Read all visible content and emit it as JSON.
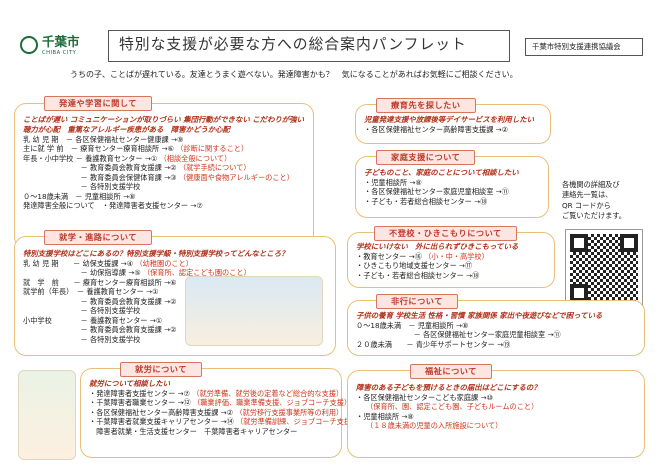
{
  "header": {
    "city_name": "千葉市",
    "city_roman": "CHIBA CITY",
    "title": "特別な支援が必要な方への総合案内パンフレット",
    "org": "千葉市特別支援連携協議会",
    "intro": "うちの子、ことばが遅れている。友達とうまく遊べない。発達障害かも？　気になることがあればお気軽にご相談ください。"
  },
  "dev": {
    "tag": "発達や学習に関して",
    "lead1": "ことばが遅い コミュニケーションが取りづらい 集団行動ができない こだわりが強い",
    "lead2": "聴力が心配　重篤なアレルギー疾患がある　障害かどうか心配",
    "r1": "乳 幼 児 期　－ 各区保健福祉センター健康課 →⑨",
    "r2a": "主に就 学 前　－ 療育センター療育相談所 →⑥ ",
    "r2b": "（診断に関すること）",
    "r3a": "年長・小中学校 － 養護教育センター →① ",
    "r3b": "（相談全般について）",
    "r4a": "　　　　　　　　－ 教育委員会教育支援課 →② ",
    "r4b": "（就学手続について）",
    "r5a": "　　　　　　　　－ 教育委員会保健体育課 →③ ",
    "r5b": "（健康面や食物アレルギーのこと）",
    "r6": "　　　　　　　　－ 各特別支援学校",
    "r7": "０～18歳未満　－ 児童相談所 →⑧",
    "r8": "発達障害全般について　・発達障害者支援センター →⑦"
  },
  "school": {
    "tag": "就学・進路について",
    "lead": "特別支援学校はどこにあるの？特別支援学級・特別支援学校ってどんなところ？",
    "r1a": "乳 幼 児 期　　－ 幼保支援課 →④ ",
    "r1b": "（幼稚園のこと）",
    "r2a": "　　　　　　　　－ 幼保指導課 →⑤ ",
    "r2b": "（保育所、認定こども園のこと）",
    "r3": "就　学　前　　－ 療育センター療育相談所 →⑥",
    "r4": "就学前（年長）　－ 養護教育センター →①",
    "r5": "　　　　　　　　－ 教育委員会教育支援課 →②",
    "r6": "　　　　　　　　－ 各特別支援学校",
    "r7": "小中学校　　　　－ 養護教育センター →①",
    "r8": "　　　　　　　　－ 教育委員会教育支援課 →②",
    "r9": "　　　　　　　　－ 各特別支援学校"
  },
  "work": {
    "tag": "就労について",
    "lead": "就労について相談したい",
    "r1a": "・発達障害者支援センター →⑦ ",
    "r1b": "（就労準備、就労後の定着など総合的な支援）",
    "r2a": "・千葉障害者職業センター →⑫ ",
    "r2b": "（職業評価、職業準備支援、ジョブコーチ支援）",
    "r3a": "・各区保健福祉センター高齢障害支援課 →② ",
    "r3b": "（就労移行支援事業所等の利用）",
    "r4a": "・千葉障害者就業支援キャリアセンター →⑭ ",
    "r4b": "（就労準備訓練、ジョブコーチ支援）",
    "r5": "　障害者就業・生活支援センター　千葉障害者キャリアセンター"
  },
  "rehab": {
    "tag": "療育先を探したい",
    "lead": "児童発達支援や放課後等デイサービスを利用したい",
    "r1": "・各区保健福祉センター高齢障害支援課 →②"
  },
  "family": {
    "tag": "家庭支援について",
    "lead": "子どものこと、家庭のことについて相談したい",
    "r1": "・児童相談所 →⑧",
    "r2": "・各区保健福祉センター家庭児童相談室 →⑪",
    "r3": "・子ども・若者総合相談センター →⑱"
  },
  "side": {
    "l1": "各機関の詳細及び",
    "l2": "連絡先一覧は、",
    "l3": "QR コードから",
    "l4": "ご覧いただけます。"
  },
  "absent": {
    "tag": "不登校・ひきこもりについて",
    "lead": "学校にいけない　外に出られずひきこもっている",
    "r1a": "・教育センター →⑯ ",
    "r1b": "（小・中・高学校）",
    "r2": "・ひきこもり地域支援センター →⑰",
    "r3": "・子ども・若者総合相談センター →⑱"
  },
  "delinq": {
    "tag": "非行について",
    "lead": "子供の養育 学校生活 性格・習慣 家族関係 家出や夜遊びなどで困っている",
    "r1": "０～18歳未満　－ 児童相談所 →⑧",
    "r2": "　　　　　　　　－ 各区保健福祉センター家庭児童相談室 →⑪",
    "r3": "２０歳未満　　－ 青少年サポートセンター →⑲"
  },
  "welfare": {
    "tag": "福祉について",
    "lead": "障害のある子どもを預けるときの届出はどこにするの？",
    "r1": "・各区保健福祉センターこども家庭課 →⑩",
    "r2": "（保育所、園、認定こども園、子どもルームのこと）",
    "r3": "・児童相談所 →⑧",
    "r4": "（１８歳未満の児童の入所施設について）"
  },
  "colors": {
    "accent_red": "#d0341c",
    "tag_fill": "#fde6e2",
    "card_border": "#e8c07a",
    "title_fill": "#fff"
  }
}
